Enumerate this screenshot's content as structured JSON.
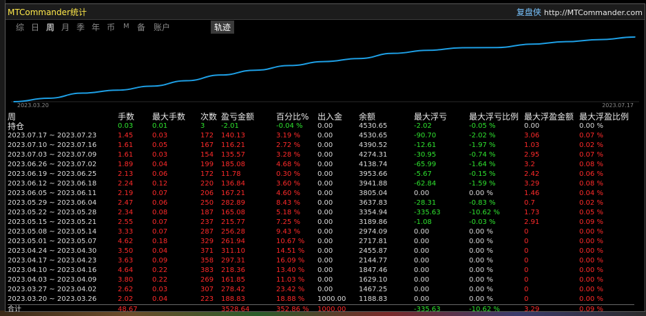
{
  "window": {
    "title": "MTCommander统计",
    "brand_cn": "复盘侠",
    "brand_url": "http://MTCommander.com"
  },
  "tabs": [
    {
      "label": "综",
      "active": false
    },
    {
      "label": "日",
      "active": false
    },
    {
      "label": "周",
      "active": true
    },
    {
      "label": "月",
      "active": false
    },
    {
      "label": "季",
      "active": false
    },
    {
      "label": "年",
      "active": false
    },
    {
      "label": "币",
      "active": false
    },
    {
      "label": "M",
      "active": false
    },
    {
      "label": "备",
      "active": false
    },
    {
      "label": "账户",
      "active": false
    }
  ],
  "track_tab": "轨迹",
  "colors": {
    "positive": "#2fe32f",
    "negative": "#ff2a2a",
    "neutral": "#dcdcdc",
    "line": "#1ea0e6",
    "title": "#ffe94a"
  },
  "chart_data": {
    "type": "line",
    "x_start_label": "2023.03.20",
    "x_end_label": "2023.07.17",
    "x": [
      "2023.03.20",
      "2023.03.27",
      "2023.04.03",
      "2023.04.10",
      "2023.04.17",
      "2023.04.24",
      "2023.05.01",
      "2023.05.08",
      "2023.05.15",
      "2023.05.22",
      "2023.05.29",
      "2023.06.05",
      "2023.06.12",
      "2023.06.19",
      "2023.06.26",
      "2023.07.03",
      "2023.07.10",
      "2023.07.17"
    ],
    "series": [
      {
        "values": [
          1000.0,
          1188.83,
          1467.25,
          1629.1,
          1847.46,
          2144.77,
          2455.87,
          2717.81,
          2974.09,
          3189.86,
          3354.94,
          3637.83,
          3805.04,
          3941.88,
          3953.66,
          4138.74,
          4274.31,
          4390.52,
          4530.65
        ]
      }
    ],
    "ylim": [
      1000,
      4600
    ],
    "grid": false
  },
  "table": {
    "period_header": "周",
    "columns": [
      "手数",
      "最大手数",
      "次数",
      "盈亏金额",
      "百分比%",
      "出入金",
      "余额",
      "最大浮亏",
      "最大浮亏比例",
      "最大浮盈金额",
      "最大浮盈比例"
    ],
    "open": {
      "label": "持仓",
      "cells": [
        "0.03",
        "0.01",
        "3",
        "-2.01",
        "-0.04 %",
        "0.00",
        "4530.65",
        "-2.02",
        "-0.05 %",
        "0.00",
        "0.00 %"
      ]
    },
    "rows": [
      {
        "period": "2023.07.17 ~ 2023.07.23",
        "cells": [
          "1.45",
          "0.03",
          "172",
          "140.13",
          "3.19 %",
          "0.00",
          "4530.65",
          "-90.70",
          "-2.02 %",
          "3.06",
          "0.07 %"
        ]
      },
      {
        "period": "2023.07.10 ~ 2023.07.16",
        "cells": [
          "1.61",
          "0.05",
          "167",
          "116.21",
          "2.72 %",
          "0.00",
          "4390.52",
          "-12.61",
          "-1.97 %",
          "1.03",
          "0.02 %"
        ]
      },
      {
        "period": "2023.07.03 ~ 2023.07.09",
        "cells": [
          "1.61",
          "0.03",
          "154",
          "135.57",
          "3.28 %",
          "0.00",
          "4274.31",
          "-30.95",
          "-0.74 %",
          "2.95",
          "0.07 %"
        ]
      },
      {
        "period": "2023.06.26 ~ 2023.07.02",
        "cells": [
          "1.89",
          "0.04",
          "199",
          "185.08",
          "4.68 %",
          "0.00",
          "4138.74",
          "-65.99",
          "-1.64 %",
          "3.2",
          "0.08 %"
        ]
      },
      {
        "period": "2023.06.19 ~ 2023.06.25",
        "cells": [
          "2.13",
          "0.06",
          "172",
          "11.78",
          "0.30 %",
          "0.00",
          "3953.66",
          "-5.67",
          "-0.15 %",
          "2.42",
          "0.06 %"
        ]
      },
      {
        "period": "2023.06.12 ~ 2023.06.18",
        "cells": [
          "2.24",
          "0.12",
          "220",
          "136.84",
          "3.60 %",
          "0.00",
          "3941.88",
          "-62.84",
          "-1.59 %",
          "3.29",
          "0.08 %"
        ]
      },
      {
        "period": "2023.06.05 ~ 2023.06.11",
        "cells": [
          "2.19",
          "0.07",
          "206",
          "167.21",
          "4.60 %",
          "0.00",
          "3805.04",
          "0.00",
          "0.00 %",
          "1.46",
          "0.04 %"
        ]
      },
      {
        "period": "2023.05.29 ~ 2023.06.04",
        "cells": [
          "2.47",
          "0.06",
          "250",
          "282.89",
          "8.43 %",
          "0.00",
          "3637.83",
          "-28.31",
          "-0.83 %",
          "0.7",
          "0.02 %"
        ]
      },
      {
        "period": "2023.05.22 ~ 2023.05.28",
        "cells": [
          "2.34",
          "0.08",
          "187",
          "165.08",
          "5.18 %",
          "0.00",
          "3354.94",
          "-335.63",
          "-10.62 %",
          "1.73",
          "0.05 %"
        ]
      },
      {
        "period": "2023.05.15 ~ 2023.05.21",
        "cells": [
          "2.55",
          "0.07",
          "237",
          "215.77",
          "7.25 %",
          "0.00",
          "3189.86",
          "-1.08",
          "-0.03 %",
          "2.91",
          "0.09 %"
        ]
      },
      {
        "period": "2023.05.08 ~ 2023.05.14",
        "cells": [
          "3.33",
          "0.07",
          "287",
          "256.28",
          "9.43 %",
          "0.00",
          "2974.09",
          "0.00",
          "0.00 %",
          "0",
          "0.00 %"
        ]
      },
      {
        "period": "2023.05.01 ~ 2023.05.07",
        "cells": [
          "4.62",
          "0.18",
          "329",
          "261.94",
          "10.67 %",
          "0.00",
          "2717.81",
          "0.00",
          "0.00 %",
          "0",
          "0.00 %"
        ]
      },
      {
        "period": "2023.04.24 ~ 2023.04.30",
        "cells": [
          "3.50",
          "0.04",
          "371",
          "311.10",
          "14.51 %",
          "0.00",
          "2455.87",
          "0.00",
          "0.00 %",
          "0",
          "0.00 %"
        ]
      },
      {
        "period": "2023.04.17 ~ 2023.04.23",
        "cells": [
          "3.63",
          "0.09",
          "358",
          "297.31",
          "16.09 %",
          "0.00",
          "2144.77",
          "0.00",
          "0.00 %",
          "0",
          "0.00 %"
        ]
      },
      {
        "period": "2023.04.10 ~ 2023.04.16",
        "cells": [
          "4.64",
          "0.22",
          "383",
          "218.36",
          "13.40 %",
          "0.00",
          "1847.46",
          "0.00",
          "0.00 %",
          "0",
          "0.00 %"
        ]
      },
      {
        "period": "2023.04.03 ~ 2023.04.09",
        "cells": [
          "3.80",
          "0.22",
          "269",
          "161.85",
          "11.03 %",
          "0.00",
          "1629.10",
          "0.00",
          "0.00 %",
          "0",
          "0.00 %"
        ]
      },
      {
        "period": "2023.03.27 ~ 2023.04.02",
        "cells": [
          "2.62",
          "0.03",
          "307",
          "278.42",
          "23.42 %",
          "0.00",
          "1467.25",
          "0.00",
          "0.00 %",
          "0",
          "0.00 %"
        ]
      },
      {
        "period": "2023.03.20 ~ 2023.03.26",
        "cells": [
          "2.02",
          "0.04",
          "223",
          "188.83",
          "18.88 %",
          "1000.00",
          "1188.83",
          "0.00",
          "0.00 %",
          "0",
          "0.00 %"
        ]
      }
    ],
    "total": {
      "label": "合计",
      "cells": [
        "48.67",
        "",
        "",
        "3528.64",
        "352.86 %",
        "1000.00",
        "",
        "-335.63",
        "-10.62 %",
        "3.29",
        "0.09 %"
      ]
    }
  }
}
